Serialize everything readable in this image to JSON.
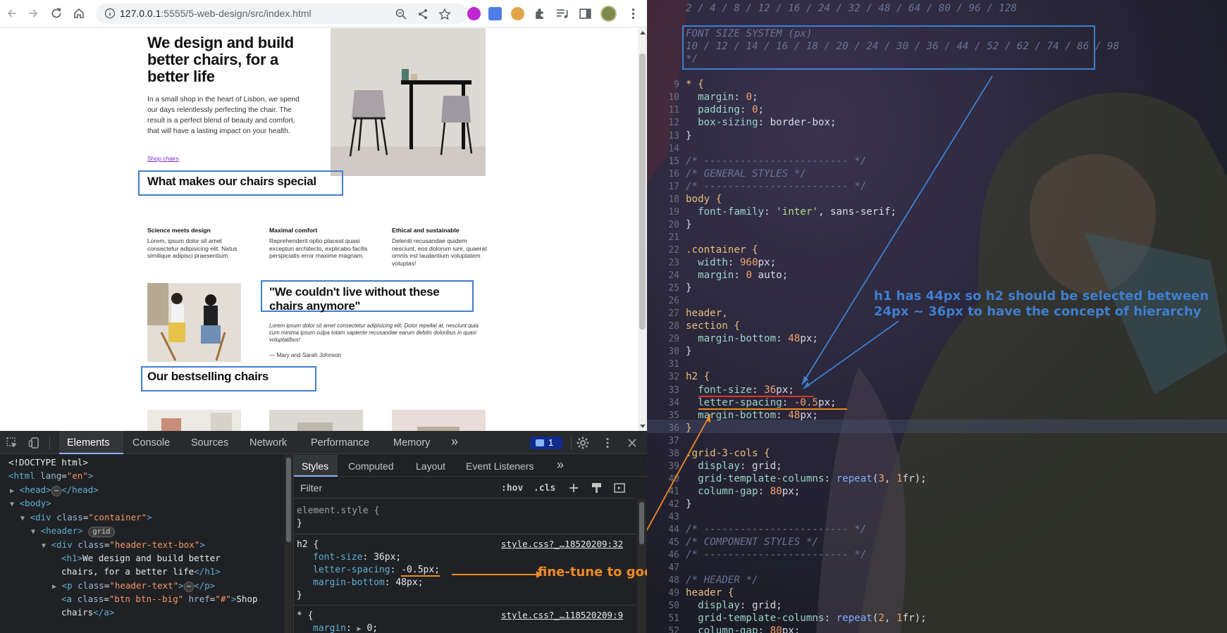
{
  "browser": {
    "url_host": "127.0.0.1",
    "url_rest": ":5555/5-web-design/src/index.html"
  },
  "page": {
    "hero": {
      "title": "We design and build better chairs, for a better life",
      "text": "In a small shop in the heart of Lisbon, we spend our days relentlessly perfecting the chair. The result is a perfect blend of beauty and comfort, that will have a lasting impact on your health.",
      "link": "Shop chairs"
    },
    "features": {
      "heading": "What makes our chairs special",
      "items": [
        {
          "title": "Science meets design",
          "text": "Lorem, ipsum dolor sit amet consectetur adipisicing elit. Natus similique adipisci praesentium."
        },
        {
          "title": "Maximal comfort",
          "text": "Reprehenderit optio placeat quasi excepturi architecto, explicabo facilis perspiciatis error maxime magnam."
        },
        {
          "title": "Ethical and sustainable",
          "text": "Deleniti recusandae quidem nesciunt, eos dolorum iure, quaerat omnis est laudantium voluptatem voluptas!"
        }
      ]
    },
    "testimonial": {
      "quote": "\"We couldn't live without these chairs anymore\"",
      "text": "Lorem ipsum dolor sit amet consectetur adipisicing elit. Dolor repellat at, nesciunt quia cum minima ipsum culpa totam sapiente recusandae earum debitis doloribus in quasi voluptatibus!",
      "author": "— Mary and Sarah Johnson"
    },
    "bestsellers": {
      "heading": "Our bestselling chairs"
    }
  },
  "devtools": {
    "tabs": [
      "Elements",
      "Console",
      "Sources",
      "Network",
      "Performance",
      "Memory"
    ],
    "more": "»",
    "issues_count": "1",
    "dom": {
      "l1": "<!DOCTYPE html>",
      "html_tag": "html",
      "lang_attr": "lang",
      "lang_val": "\"en\"",
      "head": "head",
      "body": "body",
      "div": "div",
      "class_attr": "class",
      "container_val": "\"container\"",
      "header": "header",
      "grid_badge": "grid",
      "header_text_box_val": "\"header-text-box\"",
      "h1": "h1",
      "h1_text_1": "We design and build better",
      "h1_text_2": "chairs, for a better life",
      "p": "p",
      "header_text_val": "\"header-text\"",
      "a": "a",
      "btn_val": "\"btn btn--big\"",
      "href_attr": "href",
      "href_val": "\"#\"",
      "a_text_1": "Shop",
      "a_text_2": "chairs"
    },
    "styles": {
      "tabs": [
        "Styles",
        "Computed",
        "Layout",
        "Event Listeners"
      ],
      "filter_placeholder": "Filter",
      "hov": ":hov",
      "cls": ".cls",
      "element_style": "element.style {",
      "close_brace": "}",
      "h2_selector": "h2 {",
      "h2_source": "style.css?_…18520209:32",
      "h2_props": [
        {
          "name": "font-size",
          "value": "36px;"
        },
        {
          "name": "letter-spacing",
          "value": "-0.5px;"
        },
        {
          "name": "margin-bottom",
          "value": "48px;"
        }
      ],
      "star_selector": "* {",
      "star_source": "style.css?_…118520209:9",
      "star_prop": {
        "name": "margin",
        "value": "0;"
      }
    },
    "annotation": "fine-tune to good fealing"
  },
  "editor": {
    "lines": [
      {
        "n": "",
        "t": "2 / 4 / 8 / 12 / 16 / 24 / 32 / 48 / 64 / 80 / 96 / 128",
        "cls": "c-cm"
      },
      {
        "n": "",
        "t": "",
        "cls": ""
      },
      {
        "n": "",
        "t": "FONT SIZE SYSTEM (px)",
        "cls": "c-cm"
      },
      {
        "n": "",
        "t": "10 / 12 / 14 / 16 / 18 / 20 / 24 / 30 / 36 / 44 / 52 / 62 / 74 / 86 / 98",
        "cls": "c-cm"
      },
      {
        "n": "",
        "t": "*/",
        "cls": "c-cm"
      },
      {
        "n": "",
        "t": "",
        "cls": ""
      }
    ],
    "annotation": "h1 has 44px so h2 should be selected between 24px ~ 36px to have the concept of hierarchy",
    "annotation_l1": "h1 has 44px so h2 should be selected between",
    "annotation_l2": "24px ~ 36px to have the concept of hierarchy"
  },
  "colors": {
    "annot_blue": "#3f7fcf",
    "annot_orange": "#f08a24",
    "annot_red": "#e0322a"
  }
}
